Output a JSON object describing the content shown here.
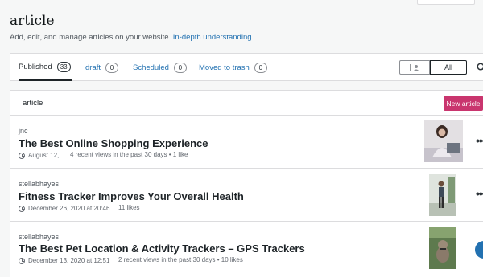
{
  "header": {
    "title": "article",
    "subtitle_text": "Add, edit, and manage articles on your website.",
    "subtitle_link": "In-depth understanding",
    "subtitle_end": " ."
  },
  "tabs": [
    {
      "label": "Published",
      "count": "33"
    },
    {
      "label": "draft",
      "count": "0"
    },
    {
      "label": "Scheduled",
      "count": "0"
    },
    {
      "label": "Moved to trash",
      "count": "0"
    }
  ],
  "filter": {
    "all_label": "All"
  },
  "list": {
    "header_label": "article",
    "new_button": "New article"
  },
  "posts": [
    {
      "author": "jnc",
      "title": "The Best Online Shopping Experience",
      "date": "August 12,",
      "stats": "4 recent views in the past 30 days • 1 like"
    },
    {
      "author": "stellabhayes",
      "title": "Fitness Tracker Improves Your Overall Health",
      "date": "December 26, 2020 at 20:46",
      "stats": "11 likes"
    },
    {
      "author": "stellabhayes",
      "title": "The Best Pet Location & Activity Trackers – GPS Trackers",
      "date": "December 13, 2020 at 12:51",
      "stats": "2 recent views in the past 30 days • 10 likes"
    }
  ],
  "more_glyph": "•••",
  "icons": {
    "search": "search-icon",
    "clock": "clock-icon",
    "more": "ellipsis-icon",
    "person": "person-icon"
  },
  "colors": {
    "accent": "#c9356e",
    "link": "#2271b1"
  }
}
